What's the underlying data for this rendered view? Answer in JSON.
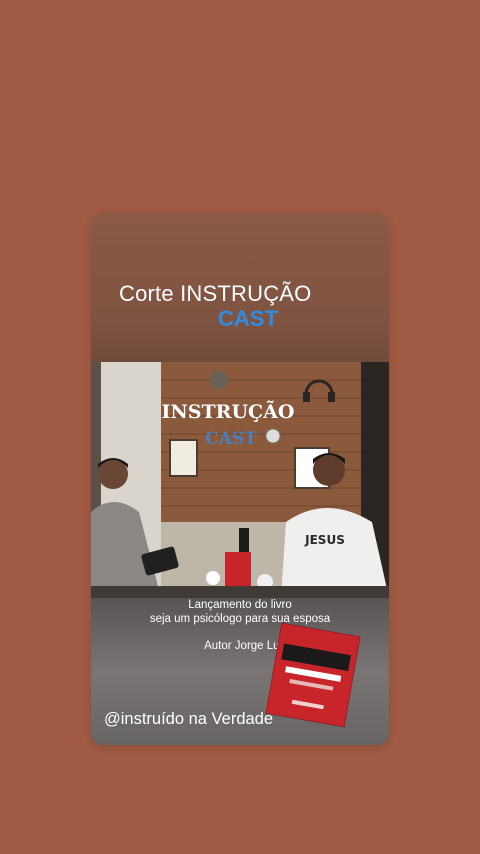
{
  "story": {
    "title_line1": "Corte INSTRUÇÃO",
    "title_line2": "CAST",
    "sign_line1": "INSTRUÇÃO",
    "sign_line2": "CAST",
    "shirt_text": "JESUS",
    "caption_line1": "Lançamento do livro",
    "caption_line2": "seja um psicólogo para sua esposa",
    "author": "Autor Jorge Luiz",
    "handle": "@instruído na Verdade"
  },
  "colors": {
    "background": "#a15a43",
    "title_accent": "#2f8de4",
    "book_red": "#c8252a"
  }
}
